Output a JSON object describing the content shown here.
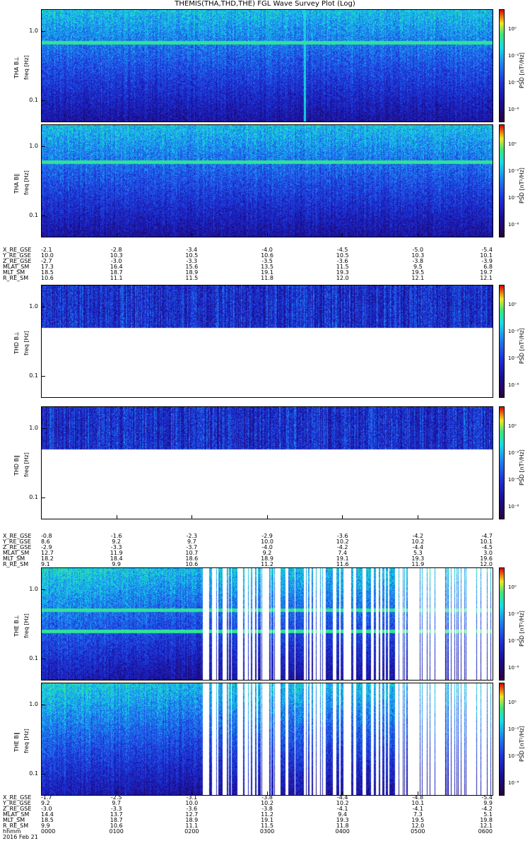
{
  "title": "THEMIS(THA,THD,THE) FGL Wave Survey Plot (Log)",
  "colorbar": {
    "label": "PSD [nT²/Hz]",
    "ticks": [
      "10⁰",
      "10⁻²",
      "10⁻⁴",
      "10⁻⁶"
    ]
  },
  "y_ticks": [
    "1.0",
    "0.1"
  ],
  "freq_label": "freq [Hz]",
  "chart_data": [
    {
      "type": "heatmap",
      "probe": "THA",
      "panels": [
        {
          "name": "THA B⊥",
          "ylabel": "THA B⊥",
          "yscale": "log",
          "ylim": [
            0.05,
            2.0
          ],
          "coverage": "full",
          "data_fmax": 2.0,
          "band_lines": [
            0.68
          ],
          "spike_times": [
            372
          ]
        },
        {
          "name": "THA B∥",
          "ylabel": "THA B∥",
          "yscale": "log",
          "ylim": [
            0.05,
            2.0
          ],
          "coverage": "full",
          "data_fmax": 2.0,
          "band_lines": [
            0.6
          ],
          "spike_times": []
        }
      ],
      "ephemeris": {
        "rows": [
          {
            "name": "X_RE_GSE",
            "values": [
              "-2.1",
              "-2.8",
              "-3.4",
              "-4.0",
              "-4.5",
              "-5.0",
              "-5.4"
            ]
          },
          {
            "name": "Y_RE_GSE",
            "values": [
              "10.0",
              "10.3",
              "10.5",
              "10.6",
              "10.5",
              "10.3",
              "10.1"
            ]
          },
          {
            "name": "Z_RE_GSE",
            "values": [
              "-2.7",
              "-3.0",
              "-3.3",
              "-3.5",
              "-3.6",
              "-3.8",
              "-3.9"
            ]
          },
          {
            "name": "MLAT_SM",
            "values": [
              "17.3",
              "16.4",
              "15.6",
              "13.5",
              "11.5",
              "9.5",
              "6.8"
            ]
          },
          {
            "name": "MLT_SM",
            "values": [
              "18.5",
              "18.7",
              "18.9",
              "19.1",
              "19.3",
              "19.5",
              "19.7"
            ]
          },
          {
            "name": "R_RE_SM",
            "values": [
              "10.6",
              "11.1",
              "11.5",
              "11.8",
              "12.0",
              "12.1",
              "12.1"
            ]
          }
        ]
      }
    },
    {
      "type": "heatmap",
      "probe": "THD",
      "panels": [
        {
          "name": "THD B⊥",
          "ylabel": "THD B⊥",
          "yscale": "log",
          "ylim": [
            0.05,
            2.0
          ],
          "coverage": "full",
          "data_fmax": 2.0,
          "data_fmin": 0.5,
          "band_lines": [],
          "spike_times": []
        },
        {
          "name": "THD B∥",
          "ylabel": "THD B∥",
          "yscale": "log",
          "ylim": [
            0.05,
            2.0
          ],
          "coverage": "full",
          "data_fmax": 2.0,
          "data_fmin": 0.5,
          "band_lines": [],
          "spike_times": []
        }
      ],
      "ephemeris": {
        "rows": [
          {
            "name": "X_RE_GSE",
            "values": [
              "-0.8",
              "-1.6",
              "-2.3",
              "-2.9",
              "-3.6",
              "-4.2",
              "-4.7"
            ]
          },
          {
            "name": "Y_RE_GSE",
            "values": [
              "8.6",
              "9.2",
              "9.7",
              "10.0",
              "10.2",
              "10.2",
              "10.1"
            ]
          },
          {
            "name": "Z_RE_GSE",
            "values": [
              "-2.9",
              "-3.3",
              "-3.7",
              "-4.0",
              "-4.2",
              "-4.4",
              "-4.5"
            ]
          },
          {
            "name": "MLAT_SM",
            "values": [
              "12.7",
              "11.9",
              "10.7",
              "9.2",
              "7.4",
              "5.3",
              "3.0"
            ]
          },
          {
            "name": "MLT_SM",
            "values": [
              "18.2",
              "18.4",
              "18.6",
              "18.9",
              "19.1",
              "19.3",
              "19.6"
            ]
          },
          {
            "name": "R_RE_SM",
            "values": [
              "9.1",
              "9.9",
              "10.6",
              "11.2",
              "11.6",
              "11.9",
              "12.0"
            ]
          }
        ]
      }
    },
    {
      "type": "heatmap",
      "probe": "THE",
      "panels": [
        {
          "name": "THE B⊥",
          "ylabel": "THE B⊥",
          "yscale": "log",
          "ylim": [
            0.05,
            2.0
          ],
          "coverage": "gappy",
          "data_fmax": 2.0,
          "band_lines": [
            0.5,
            0.25
          ],
          "spike_times": []
        },
        {
          "name": "THE B∥",
          "ylabel": "THE B∥",
          "yscale": "log",
          "ylim": [
            0.05,
            2.0
          ],
          "coverage": "gappy",
          "data_fmax": 2.0,
          "band_lines": [],
          "spike_times": []
        }
      ],
      "ephemeris": {
        "rows": [
          {
            "name": "X_RE_GSE",
            "values": [
              "-1.7",
              "-2.5",
              "-3.1",
              "-3.8",
              "-4.4",
              "-4.8",
              "-5.4"
            ]
          },
          {
            "name": "Y_RE_GSE",
            "values": [
              "9.2",
              "9.7",
              "10.0",
              "10.2",
              "10.2",
              "10.1",
              "9.9"
            ]
          },
          {
            "name": "Z_RE_GSE",
            "values": [
              "-3.0",
              "-3.3",
              "-3.6",
              "-3.8",
              "-4.1",
              "-4.1",
              "-4.2"
            ]
          },
          {
            "name": "MLAT_SM",
            "values": [
              "14.4",
              "13.7",
              "12.7",
              "11.2",
              "9.4",
              "7.3",
              "5.1"
            ]
          },
          {
            "name": "MLT_SM",
            "values": [
              "18.5",
              "18.7",
              "18.9",
              "19.1",
              "19.3",
              "19.5",
              "19.8"
            ]
          },
          {
            "name": "R_RE_SM",
            "values": [
              "9.9",
              "10.6",
              "11.1",
              "11.5",
              "11.8",
              "12.0",
              "12.1"
            ]
          },
          {
            "name": "hhmm",
            "values": [
              "0000",
              "0100",
              "0200",
              "0300",
              "0400",
              "0500",
              "0600"
            ]
          }
        ],
        "date": "2016 Feb 21"
      }
    }
  ]
}
